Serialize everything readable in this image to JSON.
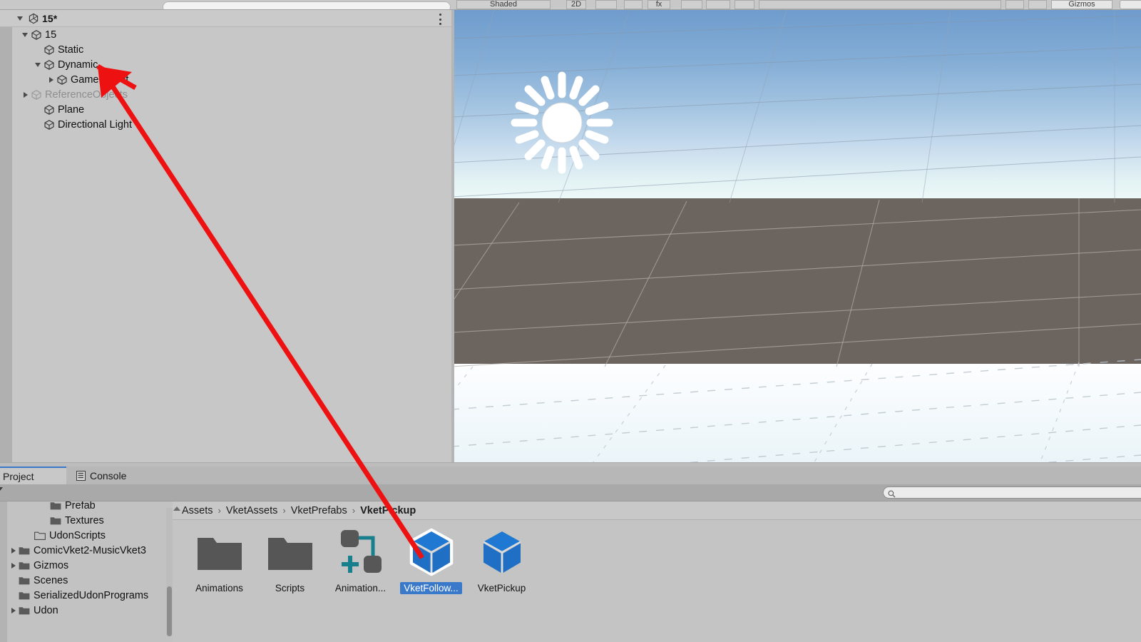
{
  "toolbar": {
    "shaded_label": "Shaded",
    "gizmos_label": "Gizmos",
    "two_d_label": "2D",
    "fx_label": "fx",
    "hierarchy_search_placeholder": ""
  },
  "hierarchy": {
    "scene_name": "15*",
    "scene_icon": "unity-logo-icon",
    "menu_icon": "kebab-menu-icon",
    "nodes": [
      {
        "label": "15",
        "indent": 0,
        "foldout": "open",
        "icon": "gameobject-cube-icon",
        "dim": false
      },
      {
        "label": "Static",
        "indent": 1,
        "foldout": "none",
        "icon": "gameobject-cube-icon",
        "dim": false
      },
      {
        "label": "Dynamic",
        "indent": 1,
        "foldout": "open",
        "icon": "gameobject-cube-icon",
        "dim": false
      },
      {
        "label": "GameObject",
        "indent": 2,
        "foldout": "closed",
        "icon": "gameobject-cube-icon",
        "dim": false
      },
      {
        "label": "ReferenceObjects",
        "indent": 0,
        "foldout": "closed",
        "icon": "gameobject-cube-icon",
        "dim": true
      },
      {
        "label": "Plane",
        "indent": 1,
        "foldout": "none",
        "icon": "gameobject-cube-icon",
        "dim": false
      },
      {
        "label": "Directional Light",
        "indent": 1,
        "foldout": "none",
        "icon": "gameobject-cube-icon",
        "dim": false
      }
    ]
  },
  "scene_view": {
    "sun_gizmo": "directional-light-gizmo-icon",
    "sky_top_color": "#6f9ccd",
    "sky_horizon_color": "#eef8f8",
    "ground_far_color": "#6b645f",
    "ground_near_color": "#f7fbfd"
  },
  "bottom_panel": {
    "tabs": [
      {
        "label": "Project",
        "icon": "project-icon",
        "active": true
      },
      {
        "label": "Console",
        "icon": "console-icon",
        "active": false
      }
    ],
    "search_placeholder": "",
    "search_value": "",
    "search_icon": "search-icon"
  },
  "project_tree": [
    {
      "label": "Prefab",
      "indent": 2,
      "foldout": "none",
      "icon": "folder-filled-icon"
    },
    {
      "label": "Textures",
      "indent": 2,
      "foldout": "none",
      "icon": "folder-filled-icon"
    },
    {
      "label": "UdonScripts",
      "indent": 1,
      "foldout": "none",
      "icon": "folder-empty-icon"
    },
    {
      "label": "ComicVket2-MusicVket3",
      "indent": 0,
      "foldout": "closed",
      "icon": "folder-filled-icon"
    },
    {
      "label": "Gizmos",
      "indent": 0,
      "foldout": "closed",
      "icon": "folder-filled-icon"
    },
    {
      "label": "Scenes",
      "indent": 0,
      "foldout": "none",
      "icon": "folder-filled-icon"
    },
    {
      "label": "SerializedUdonPrograms",
      "indent": 0,
      "foldout": "none",
      "icon": "folder-filled-icon"
    },
    {
      "label": "Udon",
      "indent": 0,
      "foldout": "closed",
      "icon": "folder-filled-icon"
    }
  ],
  "breadcrumb": {
    "separator": "›",
    "crumbs": [
      "Assets",
      "VketAssets",
      "VketPrefabs",
      "VketPickup"
    ]
  },
  "assets": [
    {
      "label": "Animations",
      "icon": "folder-asset-icon",
      "selected": false
    },
    {
      "label": "Scripts",
      "icon": "folder-asset-icon",
      "selected": false
    },
    {
      "label": "Animation...",
      "icon": "animator-controller-icon",
      "selected": false
    },
    {
      "label": "VketFollow...",
      "icon": "prefab-cube-icon",
      "selected": true
    },
    {
      "label": "VketPickup",
      "icon": "prefab-cube-icon",
      "selected": false
    }
  ],
  "annotation": {
    "arrow_color": "#ee1111",
    "arrow_from": "VketFollow prefab asset",
    "arrow_to": "Dynamic hierarchy node"
  }
}
